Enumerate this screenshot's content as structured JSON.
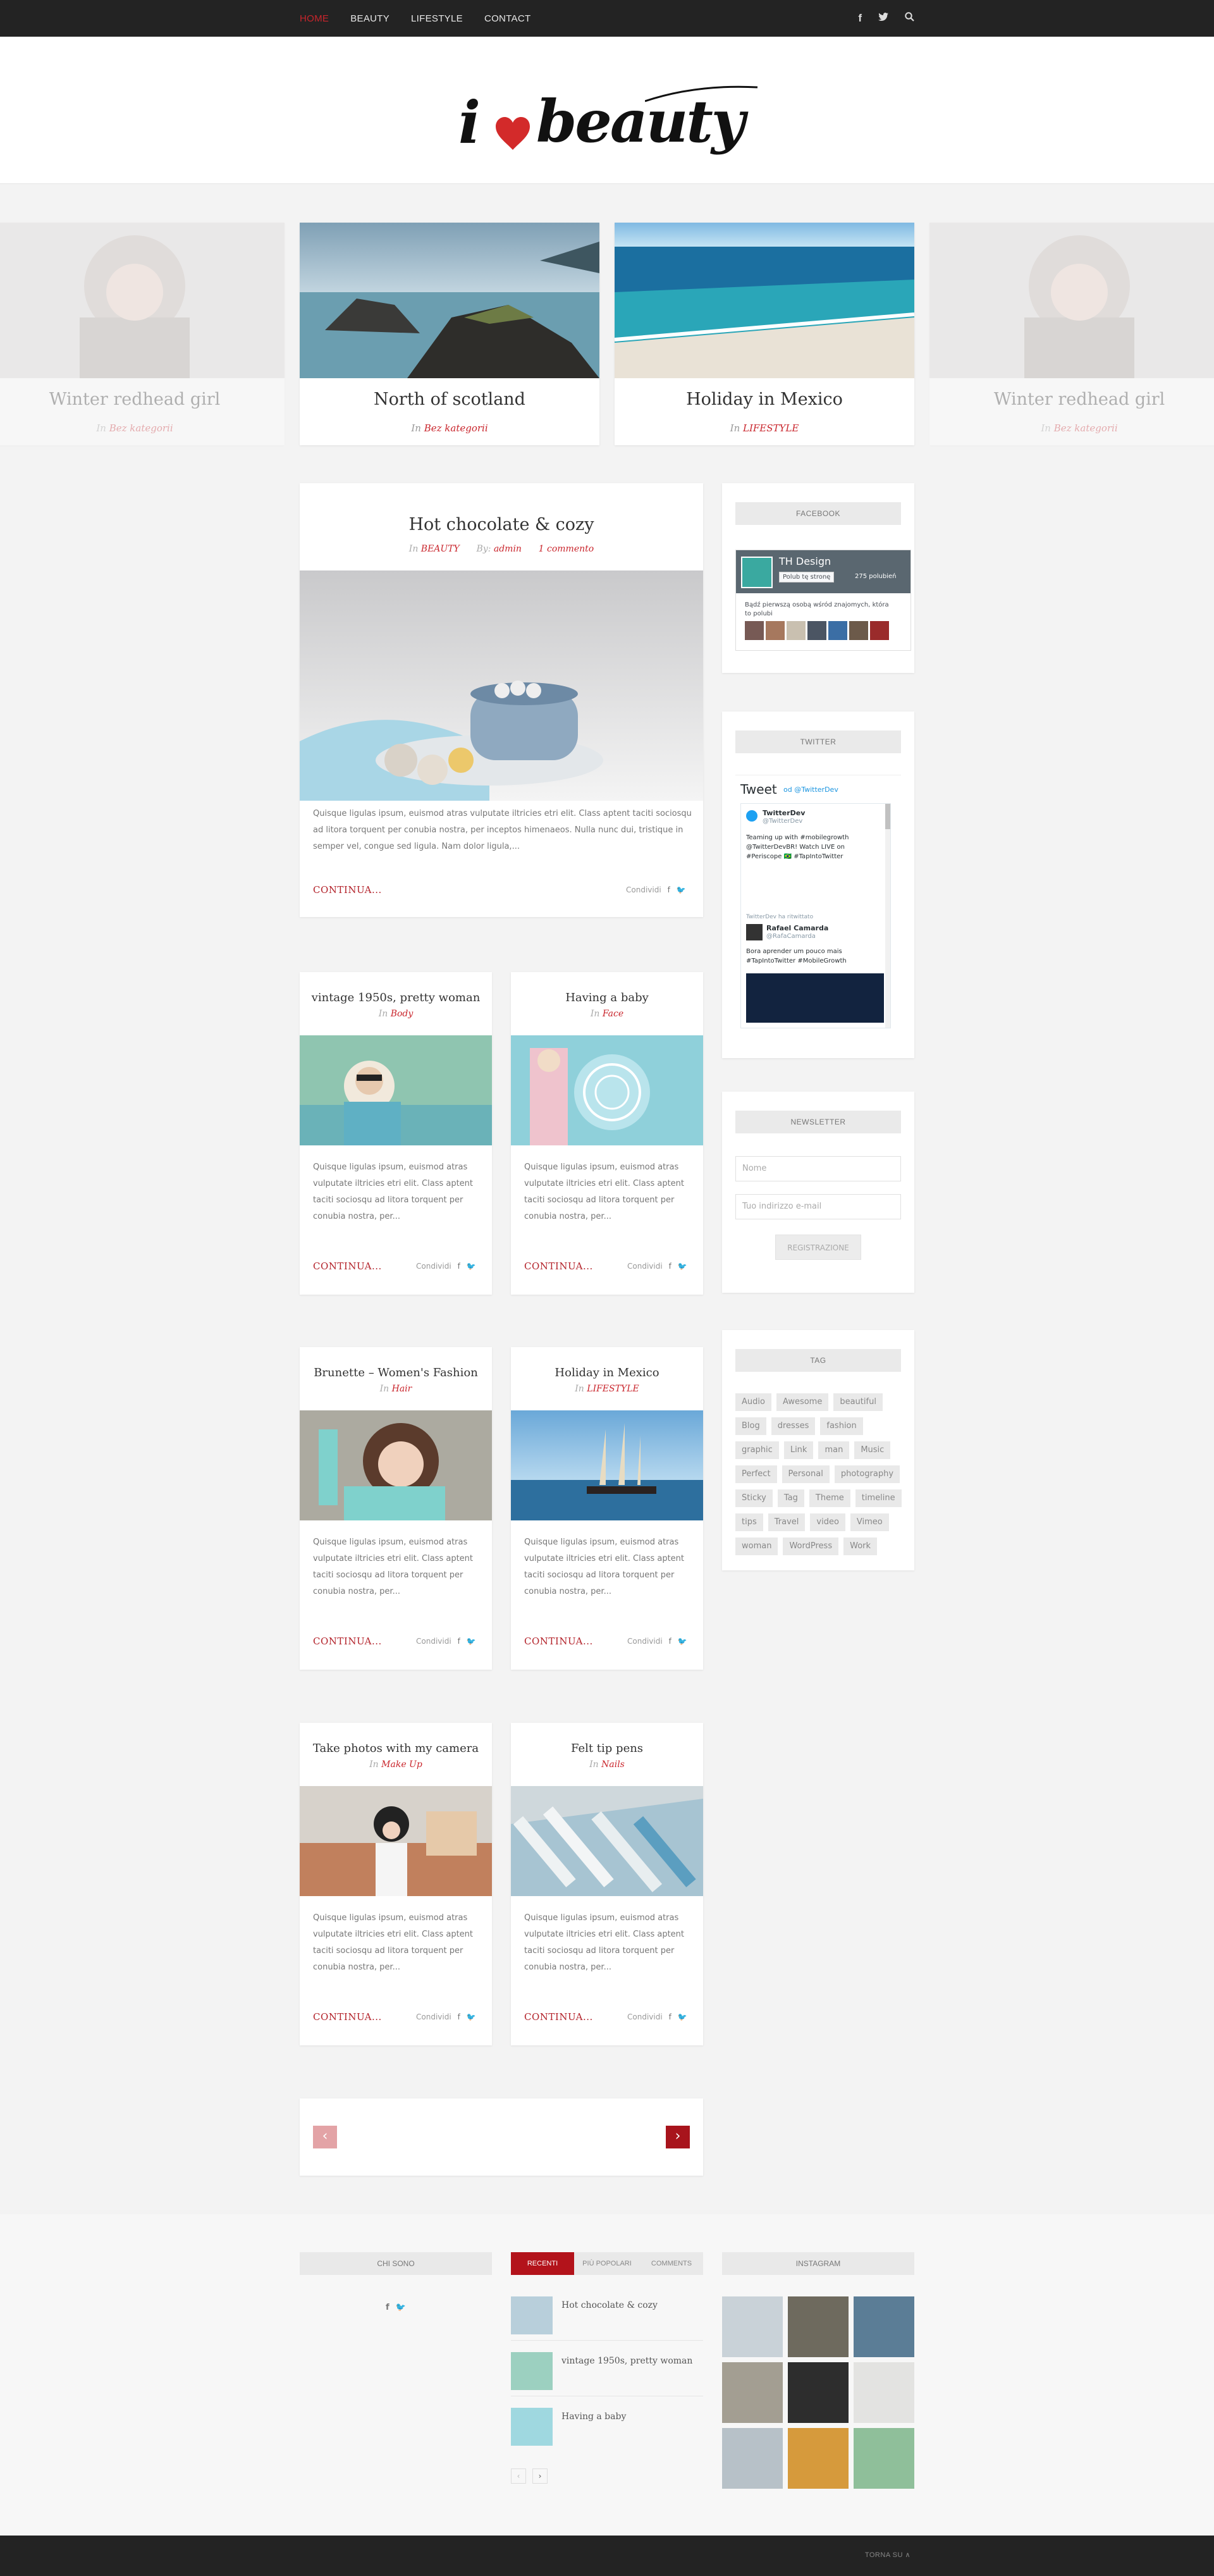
{
  "nav": {
    "items": [
      "HOME",
      "BEAUTY",
      "LIFESTYLE",
      "CONTACT"
    ],
    "icons": [
      "facebook-icon",
      "twitter-icon",
      "search-icon"
    ]
  },
  "logo": {
    "text_i": "i",
    "text_beauty": "beauty"
  },
  "slider": [
    {
      "title": "Winter redhead girl",
      "prefix": "In",
      "category": "Bez kategorii"
    },
    {
      "title": "North of scotland",
      "prefix": "In",
      "category": "Bez kategorii"
    },
    {
      "title": "Holiday in Mexico",
      "prefix": "In",
      "category": "LIFESTYLE"
    },
    {
      "title": "Winter redhead girl",
      "prefix": "In",
      "category": "Bez kategorii"
    }
  ],
  "featured": {
    "title": "Hot chocolate & cozy",
    "in_prefix": "In",
    "category": "BEAUTY",
    "by_prefix": "By:",
    "author": "admin",
    "comments": "1 commento",
    "excerpt": "Quisque ligulas ipsum, euismod atras vulputate iltricies etri elit. Class aptent taciti sociosqu ad litora torquent per conubia nostra, per inceptos himenaeos. Nulla nunc dui, tristique in semper vel, congue sed ligula. Nam dolor ligula,...",
    "more": "CONTINUA...",
    "share": "Condividi"
  },
  "posts": [
    {
      "title": "vintage 1950s, pretty woman",
      "prefix": "In",
      "category": "Body"
    },
    {
      "title": "Having a baby",
      "prefix": "In",
      "category": "Face"
    },
    {
      "title": "Brunette – Women's Fashion",
      "prefix": "In",
      "category": "Hair"
    },
    {
      "title": "Holiday in Mexico",
      "prefix": "In",
      "category": "LIFESTYLE"
    },
    {
      "title": "Take photos with my camera",
      "prefix": "In",
      "category": "Make Up"
    },
    {
      "title": "Felt tip pens",
      "prefix": "In",
      "category": "Nails"
    }
  ],
  "post_excerpt": "Quisque ligulas ipsum, euismod atras vulputate iltricies etri elit. Class aptent taciti sociosqu ad litora torquent per conubia nostra, per...",
  "post_more": "CONTINUA...",
  "post_share": "Condividi",
  "pagination": {
    "prev": "‹",
    "next": "›"
  },
  "sidebar": {
    "facebook": {
      "title": "FACEBOOK",
      "page": "TH Design",
      "like": "Polub tę stronę",
      "count": "275 polubień",
      "text": "Bądź pierwszą osobą wśród znajomych, która to polubi"
    },
    "twitter": {
      "title": "TWITTER",
      "heading": "Tweet",
      "by": "od @TwitterDev",
      "t1_name": "TwitterDev",
      "t1_handle": "@TwitterDev",
      "t1_text": "Teaming up with #mobilegrowth @TwitterDevBR! Watch LIVE on #Periscope 🇧🇷 #TapIntoTwitter",
      "retweet": "TwitterDev ha ritwittato",
      "t2_name": "Rafael Camarda",
      "t2_handle": "@RafaCamarda",
      "t2_text": "Bora aprender um pouco mais #TapIntoTwitter #MobileGrowth"
    },
    "newsletter": {
      "title": "NEWSLETTER",
      "name_ph": "Nome",
      "email_ph": "Tuo indirizzo e-mail",
      "button": "REGISTRAZIONE"
    },
    "tags": {
      "title": "TAG",
      "items": [
        "Audio",
        "Awesome",
        "beautiful",
        "Blog",
        "dresses",
        "fashion",
        "graphic",
        "Link",
        "man",
        "Music",
        "Perfect",
        "Personal",
        "photography",
        "Sticky",
        "Tag",
        "Theme",
        "timeline",
        "tips",
        "Travel",
        "video",
        "Vimeo",
        "woman",
        "WordPress",
        "Work"
      ]
    }
  },
  "footer": {
    "about": {
      "title": "CHI SONO"
    },
    "tabs": [
      "RECENTI",
      "PIÙ POPOLARI",
      "COMMENTS"
    ],
    "recent": [
      "Hot chocolate & cozy",
      "vintage 1950s, pretty woman",
      "Having a baby"
    ],
    "instagram": {
      "title": "INSTAGRAM"
    },
    "back_to_top": "TORNA SU ∧"
  },
  "colors": {
    "accent": "#c9252c",
    "dark": "#232323"
  }
}
